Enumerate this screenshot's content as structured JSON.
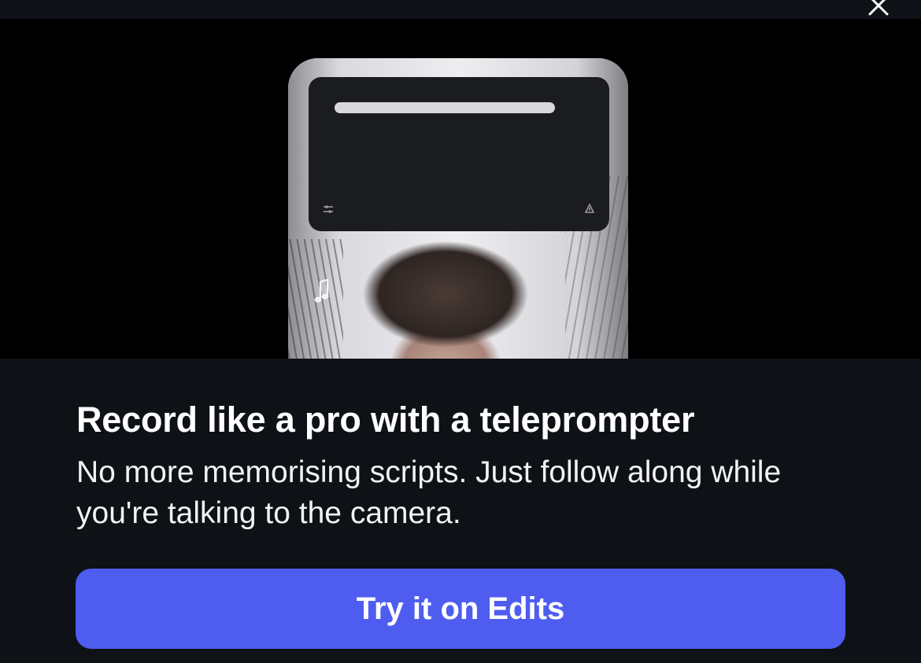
{
  "header": {
    "close_icon": "close-icon"
  },
  "media": {
    "description_icons": [
      "prompter-settings-icon",
      "prompter-speed-icon",
      "music-note-icon"
    ]
  },
  "content": {
    "title": "Record like a pro with a teleprompter",
    "description": "No more memorising scripts. Just follow along while you're talking to the camera."
  },
  "cta": {
    "label": "Try it on Edits",
    "color": "#4e5df0"
  },
  "colors": {
    "background": "#0e1116",
    "media_background": "#000000",
    "text": "#ffffff"
  }
}
